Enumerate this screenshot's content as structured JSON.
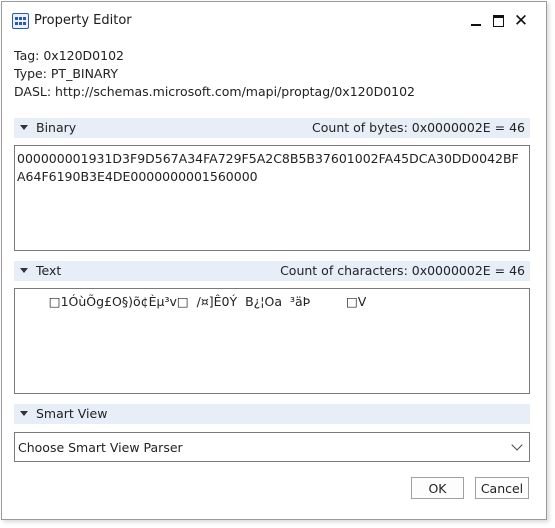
{
  "window": {
    "title": "Property Editor",
    "icon": "property-editor-app-icon"
  },
  "info": {
    "tag": "Tag: 0x120D0102",
    "type": "Type: PT_BINARY",
    "dasl": "DASL: http://schemas.microsoft.com/mapi/proptag/0x120D0102"
  },
  "binary": {
    "label": "Binary",
    "count": "Count of bytes: 0x0000002E = 46",
    "value": "000000001931D3F9D567A34FA729F5A2C8B5B37601002FA45DCA30DD0042BFA64F6190B3E4DE0000000001560000"
  },
  "text": {
    "label": "Text",
    "count": "Count of characters: 0x0000002E = 46",
    "value": "        □1ÓùÕg£O§)õ¢Èµ³v□  /¤]Ê0Ý  B¿¦Oa  ³äÞ         □V"
  },
  "smart_view": {
    "label": "Smart View",
    "selected": "Choose Smart View Parser"
  },
  "buttons": {
    "ok": "OK",
    "cancel": "Cancel"
  }
}
